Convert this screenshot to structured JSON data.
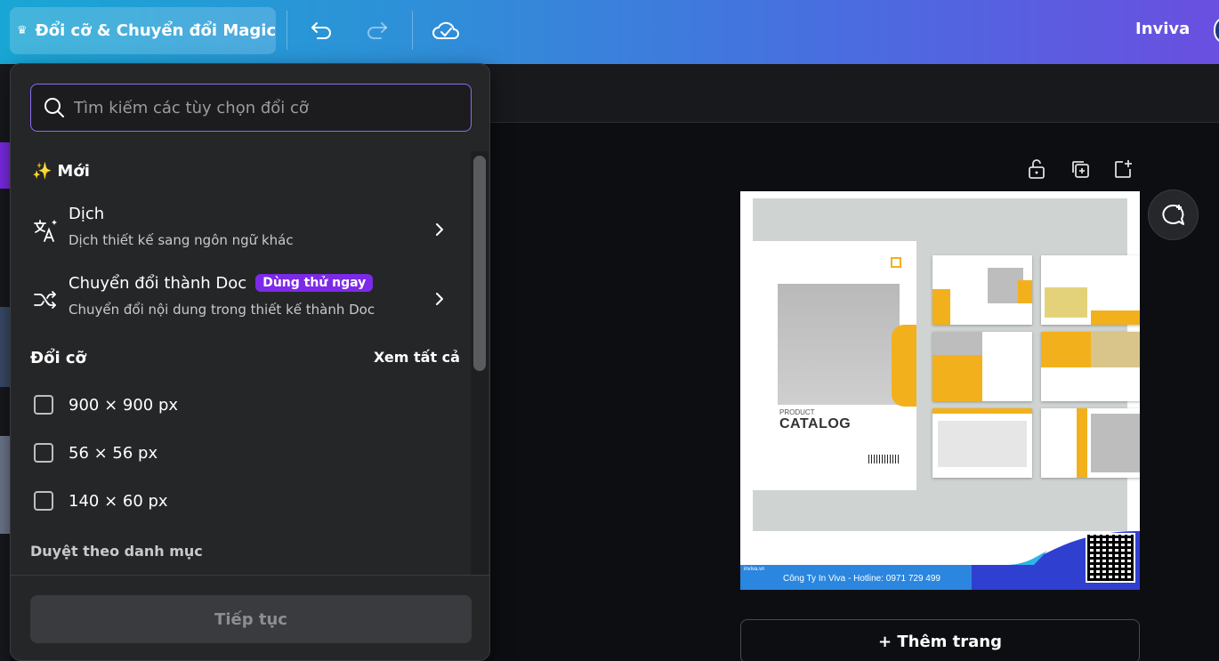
{
  "topbar": {
    "resize_label": "Đổi cỡ & Chuyển đổi Magic",
    "brand": "Inviva"
  },
  "panel": {
    "search_placeholder": "Tìm kiếm các tùy chọn đổi cỡ",
    "new_section": "Mới",
    "options": [
      {
        "title": "Dịch",
        "subtitle": "Dịch thiết kế sang ngôn ngữ khác",
        "icon": "translate-icon"
      },
      {
        "title": "Chuyển đổi thành Doc",
        "badge": "Dùng thử ngay",
        "subtitle": "Chuyển đổi nội dung trong thiết kế thành Doc",
        "icon": "shuffle-icon"
      }
    ],
    "resize_section": "Đổi cỡ",
    "see_all": "Xem tất cả",
    "sizes": [
      {
        "label": "900 × 900 px",
        "checked": false
      },
      {
        "label": "56 × 56 px",
        "checked": false
      },
      {
        "label": "140 × 60 px",
        "checked": false
      }
    ],
    "browse_label": "Duyệt theo danh mục",
    "continue_label": "Tiếp tục"
  },
  "design": {
    "product_label": "PRODUCT",
    "catalog_label": "CATALOG",
    "footer_text": "Công Ty In Viva - Hotline: 0971 729 499",
    "logo_text": "inviva.vn"
  },
  "canvas": {
    "add_page_label": "+ Thêm trang"
  },
  "colors": {
    "accent_purple": "#7d2ae8",
    "search_border": "#8b6cf0",
    "catalog_yellow": "#f2b11c",
    "footer_blue": "#2f3fd0"
  }
}
